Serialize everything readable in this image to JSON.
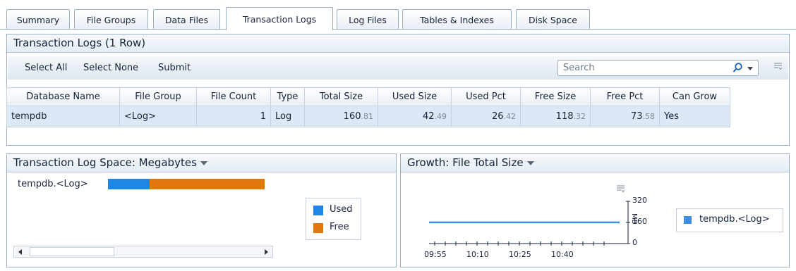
{
  "tabs": [
    {
      "label": "Summary",
      "active": false
    },
    {
      "label": "File Groups",
      "active": false
    },
    {
      "label": "Data Files",
      "active": false
    },
    {
      "label": "Transaction Logs",
      "active": true
    },
    {
      "label": "Log Files",
      "active": false
    },
    {
      "label": "Tables & Indexes",
      "active": false
    },
    {
      "label": "Disk Space",
      "active": false
    }
  ],
  "grid_panel": {
    "title": "Transaction Logs (1 Row)",
    "toolbar": {
      "select_all": "Select All",
      "select_none": "Select None",
      "submit": "Submit",
      "search_placeholder": "Search",
      "search_icon": "magnifier-icon",
      "columns_icon": "column-chooser-icon"
    },
    "columns": [
      "Database Name",
      "File Group",
      "File Count",
      "Type",
      "Total Size",
      "Used Size",
      "Used Pct",
      "Free Size",
      "Free Pct",
      "Can Grow"
    ],
    "rows": [
      {
        "database_name": "tempdb",
        "file_group": "<Log>",
        "file_count": "1",
        "type": "Log",
        "total_size": {
          "int": "160",
          "dec": ".81"
        },
        "used_size": {
          "int": "42",
          "dec": ".49"
        },
        "used_pct": {
          "int": "26",
          "dec": ".42"
        },
        "free_size": {
          "int": "118",
          "dec": ".32"
        },
        "free_pct": {
          "int": "73",
          "dec": ".58"
        },
        "can_grow": "Yes"
      }
    ]
  },
  "space_panel": {
    "title": "Transaction Log Space: Megabytes"
  },
  "growth_panel": {
    "title": "Growth: File Total Size"
  },
  "chart_data": [
    {
      "type": "bar",
      "stacked": true,
      "orientation": "horizontal",
      "categories": [
        "tempdb.<Log>"
      ],
      "series": [
        {
          "name": "Used",
          "values": [
            42.49
          ],
          "color": "#1f86e6"
        },
        {
          "name": "Free",
          "values": [
            118.32
          ],
          "color": "#e0780c"
        }
      ],
      "legend": "right"
    },
    {
      "type": "line",
      "x": [
        "09:55",
        "10:10",
        "10:25",
        "10:40"
      ],
      "xticks": [
        "09:55",
        "10:10",
        "10:25",
        "10:40"
      ],
      "ylabel": "MB",
      "ylim": [
        0,
        320
      ],
      "yticks": [
        "0",
        "160",
        "320"
      ],
      "series": [
        {
          "name": "tempdb.<Log>",
          "values": [
            160.81,
            160.81,
            160.81,
            160.81
          ],
          "color": "#3f8ee6"
        }
      ],
      "legend": "right"
    }
  ]
}
